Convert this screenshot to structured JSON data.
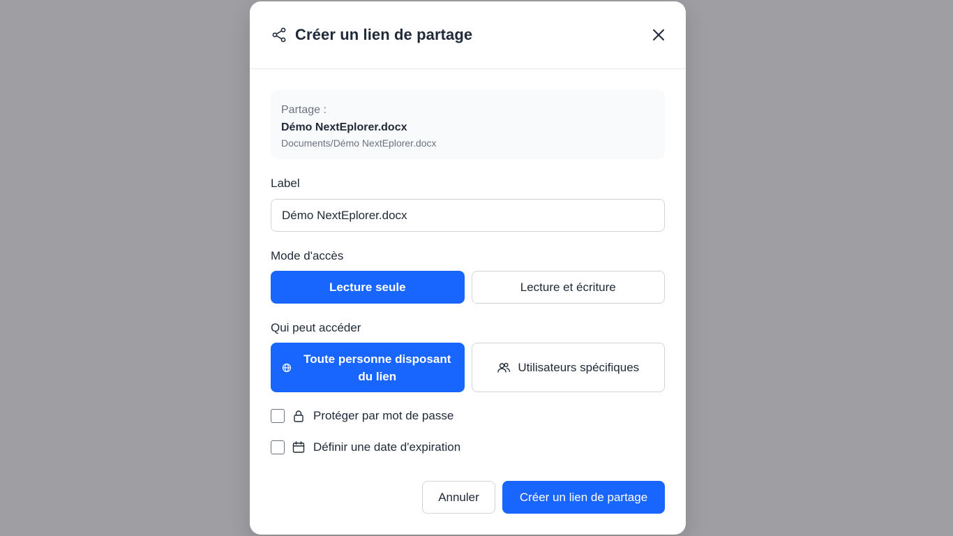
{
  "modal": {
    "title": "Créer un lien de partage",
    "header_icon": "share-icon",
    "close_icon": "close-icon"
  },
  "share": {
    "prefix": "Partage :",
    "file_name": "Démo NextEplorer.docx",
    "path": "Documents/Démo NextEplorer.docx"
  },
  "label_field": {
    "label": "Label",
    "value": "Démo NextEplorer.docx"
  },
  "access_mode": {
    "label": "Mode d'accès",
    "options": [
      "Lecture seule",
      "Lecture et écriture"
    ],
    "selected": "Lecture seule"
  },
  "who_can_access": {
    "label": "Qui peut accéder",
    "options": [
      {
        "label": "Toute personne disposant du lien",
        "icon": "globe-icon"
      },
      {
        "label": "Utilisateurs spécifiques",
        "icon": "users-icon"
      }
    ],
    "selected": "Toute personne disposant du lien"
  },
  "options": {
    "password": {
      "label": "Protéger par mot de passe",
      "icon": "lock-icon",
      "checked": false
    },
    "expiration": {
      "label": "Définir une date d'expiration",
      "icon": "calendar-icon",
      "checked": false
    }
  },
  "footer": {
    "cancel_label": "Annuler",
    "submit_label": "Créer un lien de partage"
  },
  "colors": {
    "accent": "#1966ff",
    "overlay": "#9f9ea2",
    "text": "#1f2937",
    "muted": "#6b7280"
  }
}
